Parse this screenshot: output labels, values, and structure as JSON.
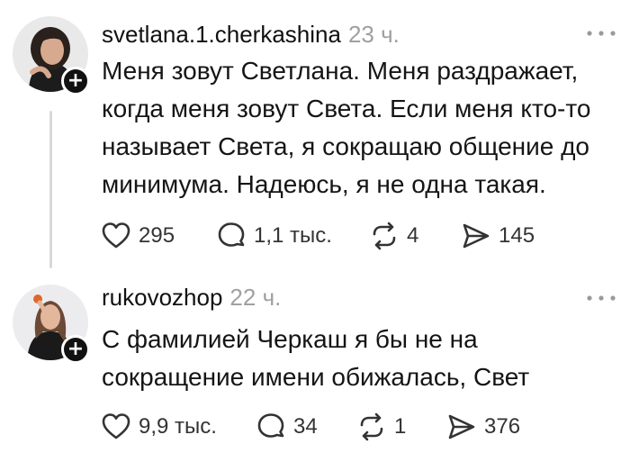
{
  "posts": [
    {
      "username": "svetlana.1.cherkashina",
      "time": "23 ч.",
      "text": "Меня зовут Светлана. Меня раздражает, когда меня зовут Света. Если меня кто-то называет Света, я сокращаю общение до минимума. Надеюсь, я не одна такая.",
      "likes": "295",
      "replies": "1,1 тыс.",
      "reposts": "4",
      "shares": "145"
    },
    {
      "username": "rukovozhop",
      "time": "22 ч.",
      "text": "С фамилией Черкаш я бы не на сокращение имени обижалась, Свет",
      "likes": "9,9 тыс.",
      "replies": "34",
      "reposts": "1",
      "shares": "376"
    }
  ],
  "icons": {
    "like": "heart-icon",
    "reply": "comment-icon",
    "repost": "repost-icon",
    "share": "share-icon",
    "more": "more-icon",
    "follow": "plus-icon"
  },
  "follow_symbol": "+"
}
